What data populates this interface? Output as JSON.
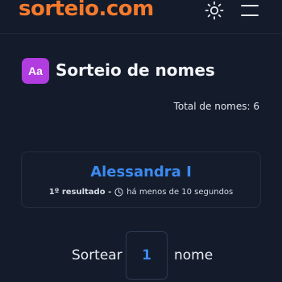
{
  "header": {
    "logo": "sorteio.com",
    "theme_icon": "sun-icon",
    "menu_icon": "hamburger-menu-icon"
  },
  "page": {
    "title_badge": "Aa",
    "title": "Sorteio de nomes",
    "total_names": "Total de nomes: 6"
  },
  "result": {
    "name": "Alessandra I",
    "position": "1º resultado -",
    "time_ago": "há menos de 10 segundos",
    "clock_icon": "clock-icon"
  },
  "draw": {
    "label_before": "Sortear",
    "quantity": "1",
    "label_after": "nome"
  },
  "colors": {
    "background": "#141b2b",
    "brand": "#f47a2c",
    "accent": "#3b8af0",
    "badge": "#b13ce0"
  }
}
